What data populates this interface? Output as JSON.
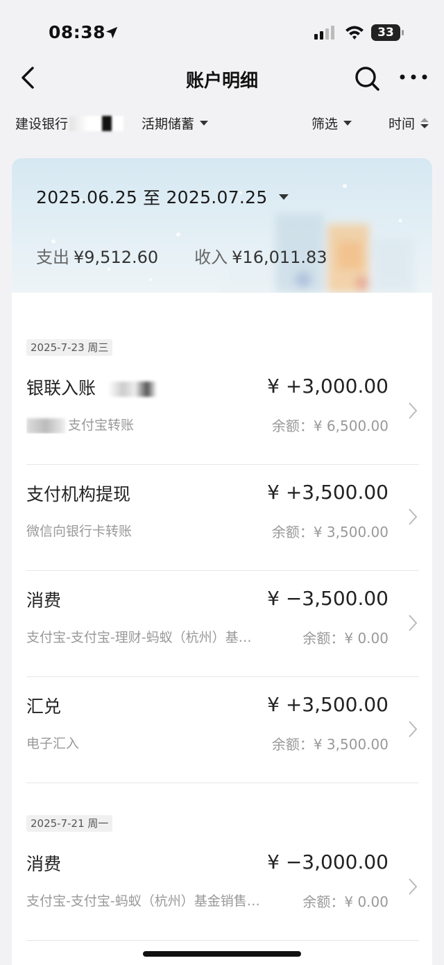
{
  "status": {
    "time": "08:38",
    "battery": "33"
  },
  "nav": {
    "title": "账户明细"
  },
  "filters": {
    "bank": "建设银行",
    "account_type": "活期储蓄",
    "filter_label": "筛选",
    "sort_label": "时间"
  },
  "summary": {
    "range_start": "2025.06.25",
    "range_sep": "至",
    "range_end": "2025.07.25",
    "expense_label": "支出",
    "expense_value": "¥9,512.60",
    "income_label": "收入",
    "income_value": "¥16,011.83"
  },
  "groups": [
    {
      "date": "2025-7-23 周三",
      "transactions": [
        {
          "title": "银联入账",
          "amount": "¥ +3,000.00",
          "desc": "支付宝转账",
          "balance": "余额：¥ 6,500.00"
        },
        {
          "title": "支付机构提现",
          "amount": "¥ +3,500.00",
          "desc": "微信向银行卡转账",
          "balance": "余额：¥ 3,500.00"
        },
        {
          "title": "消费",
          "amount": "¥ −3,500.00",
          "desc": "支付宝-支付宝-理财-蚂蚁（杭州）基…",
          "balance": "余额：¥ 0.00"
        },
        {
          "title": "汇兑",
          "amount": "¥ +3,500.00",
          "desc": "电子汇入",
          "balance": "余额：¥ 3,500.00"
        }
      ]
    },
    {
      "date": "2025-7-21 周一",
      "transactions": [
        {
          "title": "消费",
          "amount": "¥ −3,000.00",
          "desc": "支付宝-支付宝-蚂蚁（杭州）基金销售…",
          "balance": "余额：¥ 0.00"
        }
      ]
    }
  ]
}
